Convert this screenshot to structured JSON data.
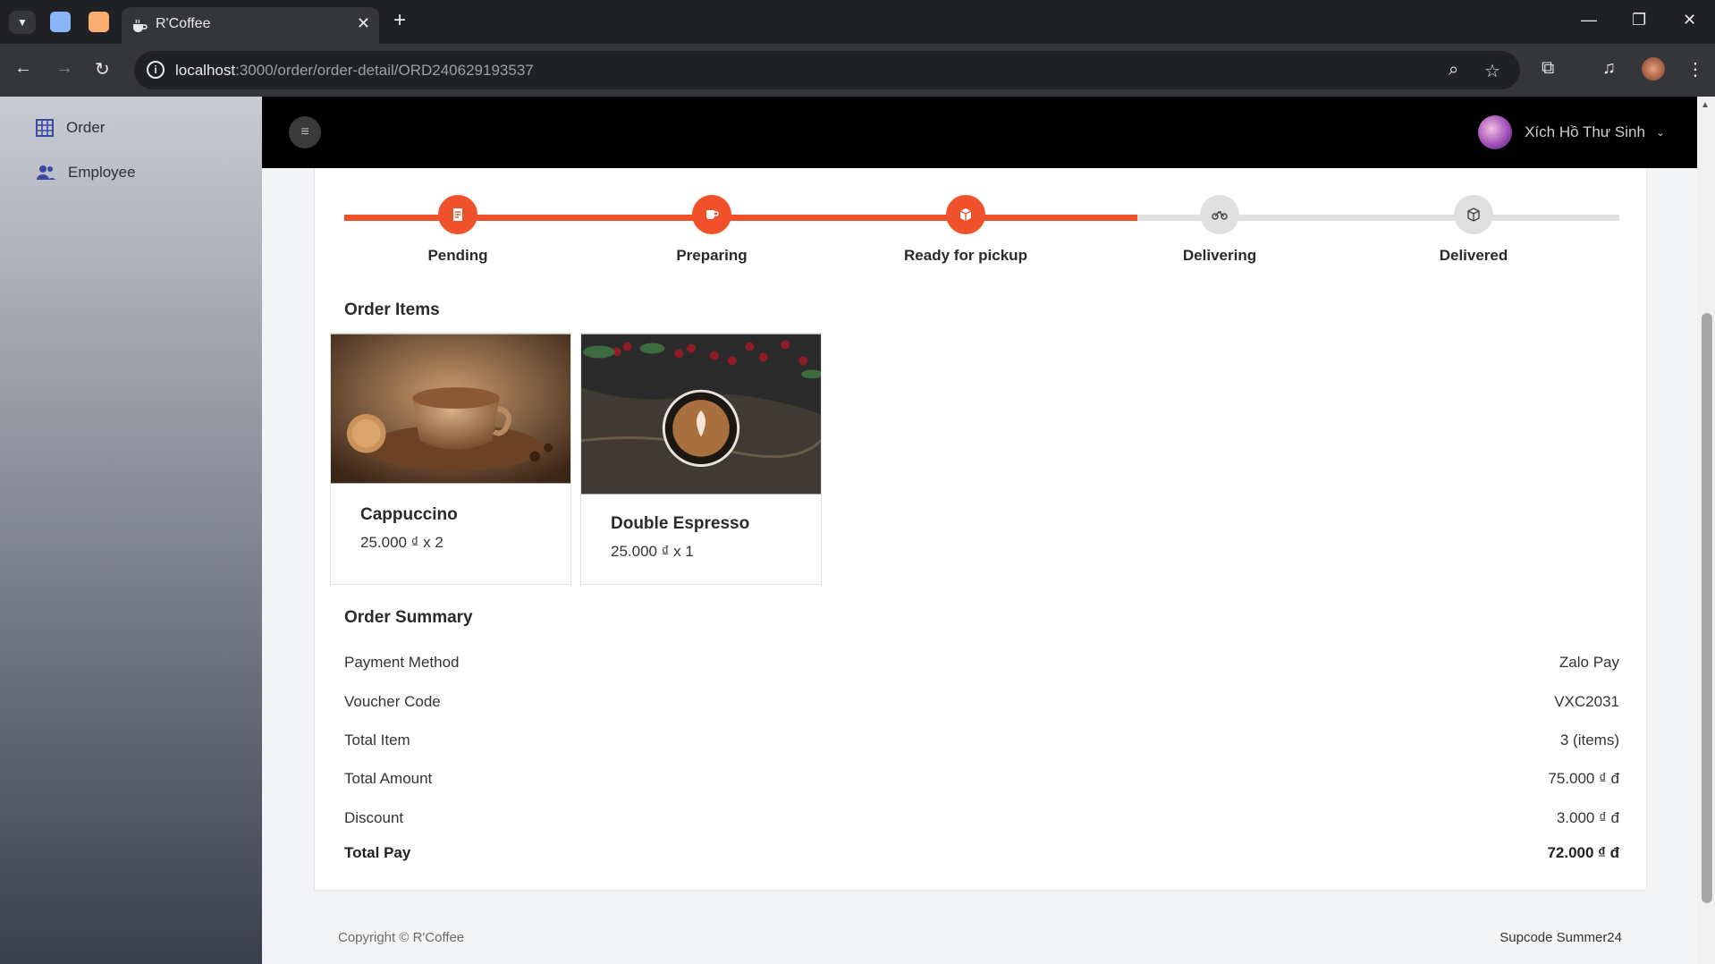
{
  "browser": {
    "tab_title": "R'Coffee",
    "url_host": "localhost",
    "url_path": ":3000/order/order-detail/ORD240629193537"
  },
  "sidebar": {
    "items": [
      {
        "label": "Order",
        "icon": "grid-table-icon"
      },
      {
        "label": "Employee",
        "icon": "people-icon"
      }
    ]
  },
  "header": {
    "user_name": "Xích Hồ Thư Sinh"
  },
  "progress": {
    "completed_steps": 3,
    "steps": [
      {
        "label": "Pending",
        "icon": "receipt-icon",
        "done": true
      },
      {
        "label": "Preparing",
        "icon": "cup-icon",
        "done": true
      },
      {
        "label": "Ready for pickup",
        "icon": "box-icon",
        "done": true
      },
      {
        "label": "Delivering",
        "icon": "bike-icon",
        "done": false
      },
      {
        "label": "Delivered",
        "icon": "package-icon",
        "done": false
      }
    ],
    "colors": {
      "active": "#f0512a",
      "inactive": "#e0e0e0"
    }
  },
  "order_items": {
    "title": "Order Items",
    "items": [
      {
        "name": "Cappuccino",
        "price": "25.000 ₫ x 2"
      },
      {
        "name": "Double Espresso",
        "price": "25.000 ₫ x 1"
      }
    ]
  },
  "summary": {
    "title": "Order Summary",
    "rows": [
      {
        "label": "Payment Method",
        "value": "Zalo Pay"
      },
      {
        "label": "Voucher Code",
        "value": "VXC2031"
      },
      {
        "label": "Total Item",
        "value": "3 (items)"
      },
      {
        "label": "Total Amount",
        "value": "75.000 ₫ đ"
      },
      {
        "label": "Discount",
        "value": "3.000 ₫ đ"
      }
    ],
    "total": {
      "label": "Total Pay",
      "value": "72.000 ₫ đ"
    }
  },
  "footer": {
    "copyright": "Copyright © R'Coffee",
    "credit": "Supcode Summer24"
  }
}
